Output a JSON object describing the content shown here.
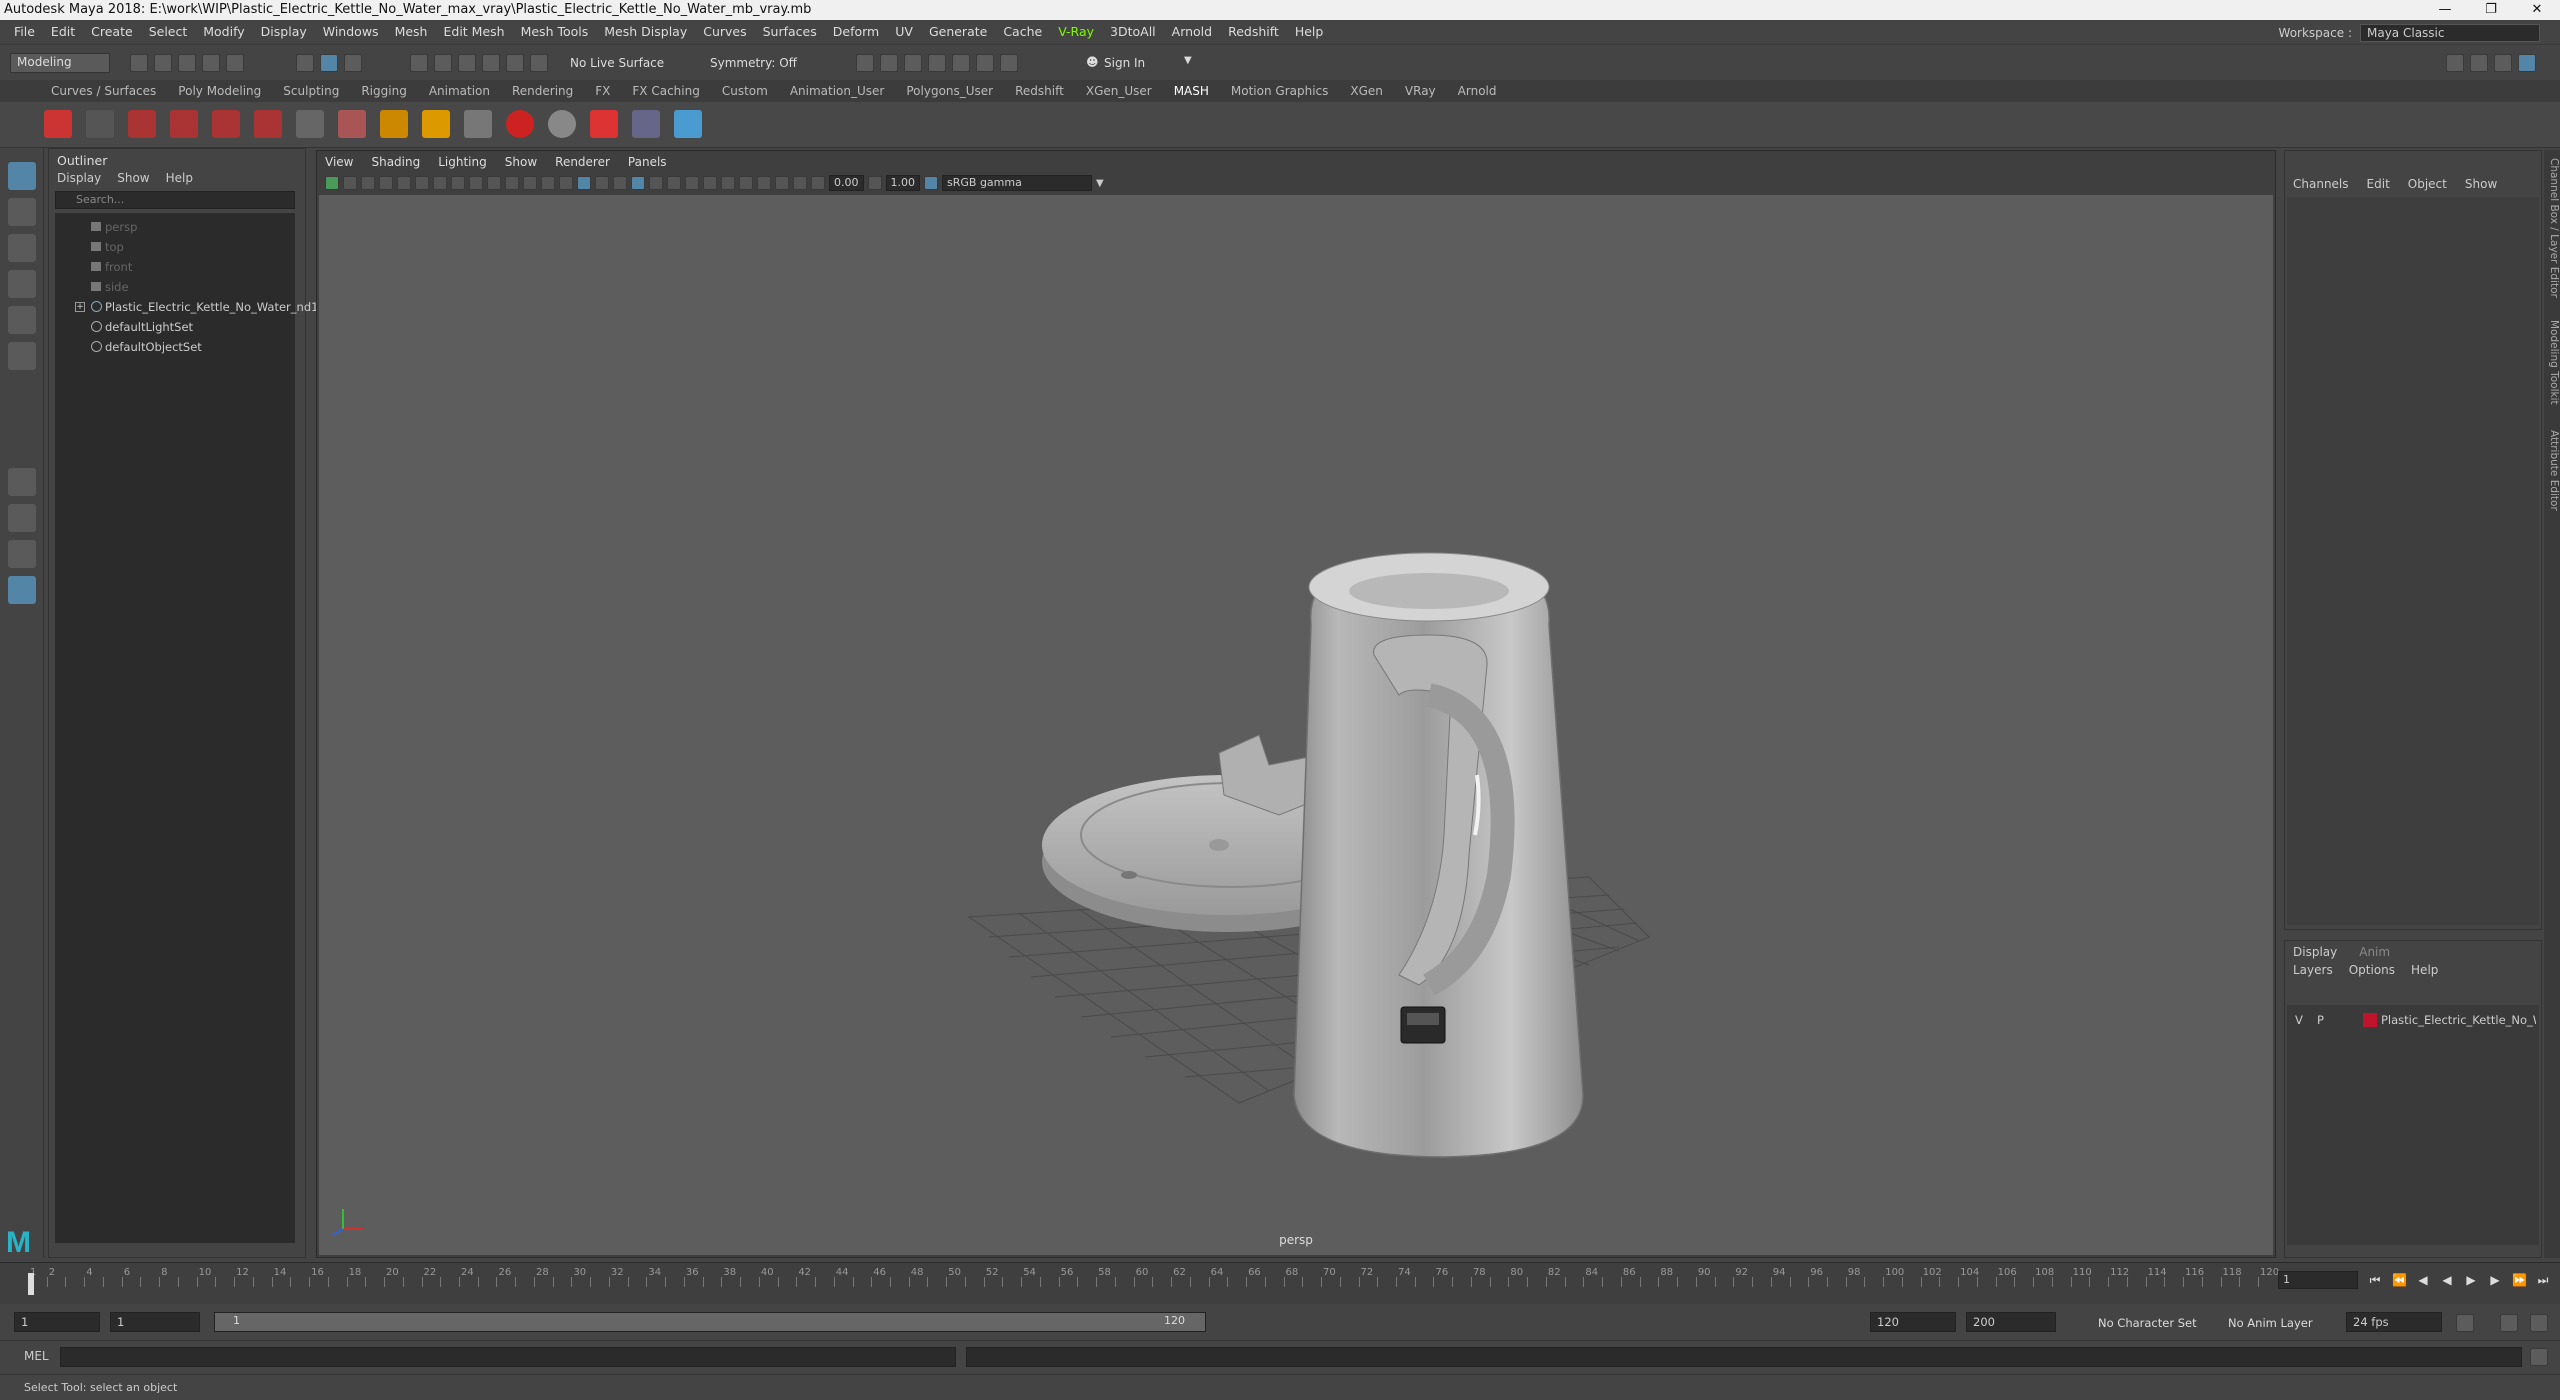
{
  "window": {
    "title": "Autodesk Maya 2018: E:\\work\\WIP\\Plastic_Electric_Kettle_No_Water_max_vray\\Plastic_Electric_Kettle_No_Water_mb_vray.mb",
    "minimize": "—",
    "restore": "❐",
    "close": "✕"
  },
  "menubar": [
    "File",
    "Edit",
    "Create",
    "Select",
    "Modify",
    "Display",
    "Windows",
    "Mesh",
    "Edit Mesh",
    "Mesh Tools",
    "Mesh Display",
    "Curves",
    "Surfaces",
    "Deform",
    "UV",
    "Generate",
    "Cache",
    "V-Ray",
    "3DtoAll",
    "Arnold",
    "Redshift",
    "Help"
  ],
  "workspace": {
    "label": "Workspace :",
    "value": "Maya Classic"
  },
  "statusline": {
    "mode": "Modeling",
    "live_surface": "No Live Surface",
    "symmetry": "Symmetry: Off",
    "sign_in": "Sign In"
  },
  "shelf_tabs": [
    "Curves / Surfaces",
    "Poly Modeling",
    "Sculpting",
    "Rigging",
    "Animation",
    "Rendering",
    "FX",
    "FX Caching",
    "Custom",
    "Animation_User",
    "Polygons_User",
    "Redshift",
    "XGen_User",
    "MASH",
    "Motion Graphics",
    "XGen",
    "VRay",
    "Arnold"
  ],
  "active_shelf_tab": "MASH",
  "outliner": {
    "title": "Outliner",
    "menu": [
      "Display",
      "Show",
      "Help"
    ],
    "search_placeholder": "Search...",
    "items": [
      {
        "name": "persp",
        "kind": "camera"
      },
      {
        "name": "top",
        "kind": "camera"
      },
      {
        "name": "front",
        "kind": "camera"
      },
      {
        "name": "side",
        "kind": "camera"
      },
      {
        "name": "Plastic_Electric_Kettle_No_Water_nd1",
        "kind": "group"
      },
      {
        "name": "defaultLightSet",
        "kind": "set"
      },
      {
        "name": "defaultObjectSet",
        "kind": "set"
      }
    ],
    "expand_glyph": "+"
  },
  "viewport": {
    "menu": [
      "View",
      "Shading",
      "Lighting",
      "Show",
      "Renderer",
      "Panels"
    ],
    "exposure": "0.00",
    "gamma": "1.00",
    "color_space": "sRGB gamma",
    "camera_label": "persp"
  },
  "channel_box": {
    "menu": [
      "Channels",
      "Edit",
      "Object",
      "Show"
    ]
  },
  "layer_editor": {
    "tabs": [
      "Display",
      "Anim"
    ],
    "menu": [
      "Layers",
      "Options",
      "Help"
    ],
    "layer": {
      "v": "V",
      "p": "P",
      "name": "Plastic_Electric_Kettle_No_Water",
      "color": "#c0142c"
    }
  },
  "side_tabs": [
    "Channel Box / Layer Editor",
    "Modeling Toolkit",
    "Attribute Editor"
  ],
  "timeline": {
    "tick_labels": [
      "1",
      "2",
      "4",
      "6",
      "8",
      "10",
      "12",
      "14",
      "16",
      "18",
      "20",
      "22",
      "24",
      "26",
      "28",
      "30",
      "32",
      "34",
      "36",
      "38",
      "40",
      "42",
      "44",
      "46",
      "48",
      "50",
      "52",
      "54",
      "56",
      "58",
      "60",
      "62",
      "64",
      "66",
      "68",
      "70",
      "72",
      "74",
      "76",
      "78",
      "80",
      "82",
      "84",
      "86",
      "88",
      "90",
      "92",
      "94",
      "96",
      "98",
      "100",
      "102",
      "104",
      "106",
      "108",
      "110",
      "112",
      "114",
      "116",
      "118",
      "120"
    ],
    "current_frame": "1"
  },
  "range": {
    "start": "1",
    "playback_start": "1",
    "range_start_label": "1",
    "range_end_label": "120",
    "playback_end": "120",
    "end": "200",
    "character_set": "No Character Set",
    "anim_layer": "No Anim Layer",
    "fps": "24 fps"
  },
  "cmdline": {
    "label": "MEL"
  },
  "helpline": {
    "text": "Select Tool: select an object"
  }
}
